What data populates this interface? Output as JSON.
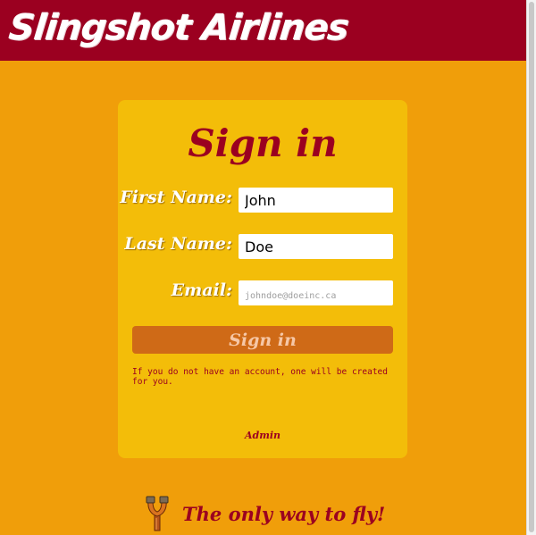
{
  "header": {
    "logo_text": "Slingshot Airlines"
  },
  "signin": {
    "title": "Sign in",
    "first_name_label": "First Name:",
    "first_name_value": "John",
    "last_name_label": "Last Name:",
    "last_name_value": "Doe",
    "email_label": "Email:",
    "email_value": "",
    "email_placeholder": "johndoe@doeinc.ca",
    "submit_label": "Sign in",
    "note": "If you do not have an account, one will be created for you.",
    "admin_link": "Admin"
  },
  "footer": {
    "tagline": "The only way to fly!"
  },
  "colors": {
    "page_bg": "#f09e0a",
    "header_bg": "#9b0020",
    "card_bg": "#f3bd09",
    "button_bg": "#cf6a17",
    "accent": "#9b0020"
  }
}
